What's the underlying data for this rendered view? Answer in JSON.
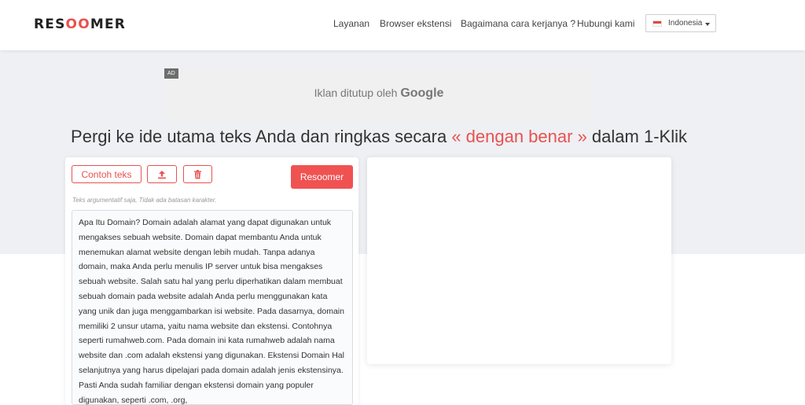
{
  "header": {
    "logo": {
      "pre": "RES",
      "oo": "OO",
      "post": "MER"
    },
    "nav": [
      "Layanan",
      "Browser ekstensi",
      "Bagaimana cara kerjanya ?",
      "Hubungi kami"
    ],
    "language": "Indonesia"
  },
  "ad": {
    "badge": "AD",
    "text": "Iklan ditutup oleh",
    "brand": "Google"
  },
  "headline": {
    "before": "Pergi ke ide utama teks Anda dan ringkas secara ",
    "accent": "« dengan benar »",
    "after": " dalam 1-Klik"
  },
  "toolbar": {
    "example_label": "Contoh teks",
    "upload_icon": "upload-icon",
    "delete_icon": "trash-icon",
    "submit_label": "Resoomer"
  },
  "hint": "Teks argumentatif saja, Tidak ada batasan karakter.",
  "input_text": "Apa Itu Domain? Domain adalah alamat yang dapat digunakan untuk mengakses sebuah website. Domain dapat membantu Anda untuk menemukan alamat website dengan lebih mudah. Tanpa adanya domain, maka Anda perlu menulis IP server untuk bisa mengakses sebuah website. Salah satu hal yang perlu diperhatikan dalam membuat sebuah domain pada website adalah Anda perlu menggunakan kata yang unik dan juga menggambarkan isi website. Pada dasarnya, domain memiliki 2 unsur utama, yaitu nama website dan ekstensi. Contohnya seperti rumahweb.com. Pada domain ini kata rumahweb adalah nama website dan .com adalah ekstensi yang digunakan.  Ekstensi Domain Hal selanjutnya yang harus dipelajari pada domain adalah jenis ekstensinya. Pasti Anda sudah familiar dengan ekstensi domain yang populer digunakan, seperti .com, .org,",
  "colors": {
    "accent": "#e8524f",
    "button": "#f05252",
    "band": "#eef0f4"
  }
}
